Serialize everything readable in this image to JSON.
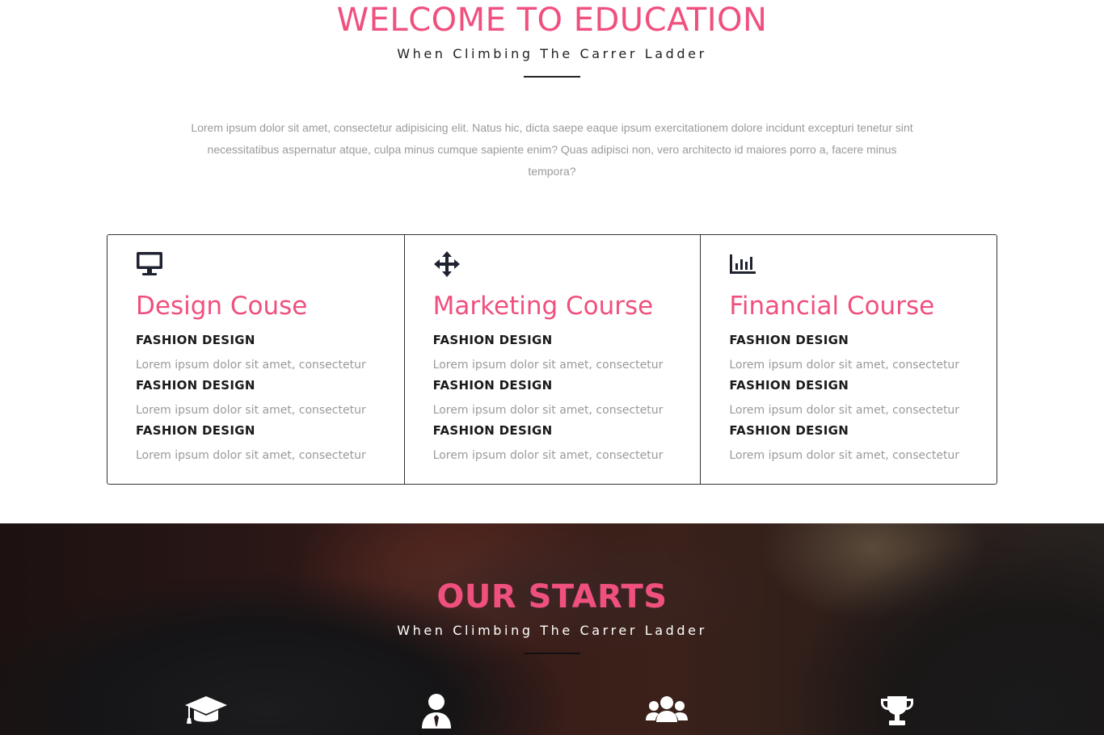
{
  "welcome": {
    "title": "WELCOME TO EDUCATION",
    "subtitle": "When Climbing The Carrer Ladder",
    "paragraph": "Lorem ipsum dolor sit amet, consectetur adipisicing elit. Natus hic, dicta saepe eaque ipsum exercitationem dolore incidunt excepturi tenetur sint necessitatibus aspernatur atque, culpa minus cumque sapiente enim? Quas adipisci non, vero architecto id maiores porro a, facere minus tempora?"
  },
  "courses": [
    {
      "icon": "monitor-icon",
      "title": "Design Couse",
      "items": [
        {
          "label": "FASHION DESIGN",
          "text": "Lorem ipsum dolor sit amet, consectetur"
        },
        {
          "label": "FASHION DESIGN",
          "text": "Lorem ipsum dolor sit amet, consectetur"
        },
        {
          "label": "FASHION DESIGN",
          "text": "Lorem ipsum dolor sit amet, consectetur"
        }
      ]
    },
    {
      "icon": "move-arrows-icon",
      "title": "Marketing Course",
      "items": [
        {
          "label": "FASHION DESIGN",
          "text": "Lorem ipsum dolor sit amet, consectetur"
        },
        {
          "label": "FASHION DESIGN",
          "text": "Lorem ipsum dolor sit amet, consectetur"
        },
        {
          "label": "FASHION DESIGN",
          "text": "Lorem ipsum dolor sit amet, consectetur"
        }
      ]
    },
    {
      "icon": "bar-chart-icon",
      "title": "Financial Course",
      "items": [
        {
          "label": "FASHION DESIGN",
          "text": "Lorem ipsum dolor sit amet, consectetur"
        },
        {
          "label": "FASHION DESIGN",
          "text": "Lorem ipsum dolor sit amet, consectetur"
        },
        {
          "label": "FASHION DESIGN",
          "text": "Lorem ipsum dolor sit amet, consectetur"
        }
      ]
    }
  ],
  "starts": {
    "title": "OUR STARTS",
    "subtitle": "When Climbing The Carrer Ladder",
    "icons": [
      "graduation-cap-icon",
      "user-tie-icon",
      "users-group-icon",
      "trophy-icon"
    ]
  },
  "colors": {
    "accent": "#f0507e",
    "text_dark": "#1a1a1a",
    "text_muted": "#9a9a9a"
  }
}
